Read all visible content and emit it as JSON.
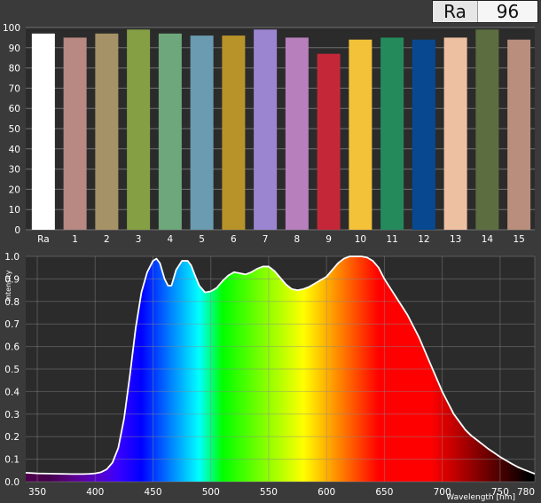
{
  "ra_display": {
    "label": "Ra",
    "value": "96"
  },
  "chart_data": [
    {
      "type": "bar",
      "categories": [
        "Ra",
        "1",
        "2",
        "3",
        "4",
        "5",
        "6",
        "7",
        "8",
        "9",
        "10",
        "11",
        "12",
        "13",
        "14",
        "15"
      ],
      "values": [
        97,
        95,
        97,
        99,
        97,
        96,
        96,
        99,
        95,
        87,
        94,
        95,
        94,
        95,
        99,
        94
      ],
      "colors": [
        "#ffffff",
        "#b88882",
        "#a59266",
        "#85a044",
        "#6ea77c",
        "#6a9bb0",
        "#b8932a",
        "#9c85d0",
        "#b87fbd",
        "#c42838",
        "#f4c238",
        "#248a5c",
        "#084890",
        "#eec0a2",
        "#5c6d40",
        "#b98e7d"
      ],
      "ylim": [
        0,
        100
      ],
      "yticks": [
        0,
        10,
        20,
        30,
        40,
        50,
        60,
        70,
        80,
        90,
        100
      ],
      "grid": true
    },
    {
      "type": "area",
      "xlabel": "Wavelength [nm]",
      "ylabel": "Intensity",
      "xlim": [
        340,
        780
      ],
      "ylim": [
        0,
        1.0
      ],
      "xticks": [
        350,
        400,
        450,
        500,
        550,
        600,
        650,
        700,
        750,
        780
      ],
      "yticks": [
        "0.0",
        "0.1",
        "0.2",
        "0.3",
        "0.4",
        "0.5",
        "0.6",
        "0.7",
        "0.8",
        "0.9",
        "1.0"
      ],
      "grid": true,
      "x": [
        340,
        350,
        360,
        370,
        380,
        390,
        395,
        400,
        405,
        410,
        415,
        420,
        425,
        430,
        435,
        440,
        445,
        450,
        453,
        456,
        460,
        463,
        466,
        470,
        475,
        480,
        483,
        486,
        490,
        495,
        500,
        505,
        510,
        515,
        520,
        525,
        530,
        535,
        540,
        545,
        550,
        555,
        560,
        565,
        570,
        575,
        580,
        585,
        590,
        595,
        600,
        605,
        610,
        615,
        620,
        625,
        630,
        635,
        640,
        645,
        650,
        655,
        660,
        665,
        670,
        675,
        680,
        685,
        690,
        695,
        700,
        705,
        710,
        715,
        720,
        725,
        730,
        735,
        740,
        745,
        750,
        755,
        760,
        765,
        770,
        775,
        780
      ],
      "y": [
        0.04,
        0.037,
        0.036,
        0.035,
        0.034,
        0.034,
        0.035,
        0.037,
        0.042,
        0.055,
        0.085,
        0.15,
        0.28,
        0.47,
        0.68,
        0.84,
        0.93,
        0.98,
        0.99,
        0.97,
        0.9,
        0.87,
        0.87,
        0.94,
        0.98,
        0.98,
        0.96,
        0.92,
        0.87,
        0.84,
        0.845,
        0.86,
        0.89,
        0.915,
        0.93,
        0.925,
        0.92,
        0.93,
        0.945,
        0.955,
        0.955,
        0.935,
        0.905,
        0.875,
        0.855,
        0.85,
        0.855,
        0.865,
        0.88,
        0.895,
        0.91,
        0.94,
        0.97,
        0.99,
        1.0,
        1.0,
        1.0,
        0.995,
        0.98,
        0.95,
        0.9,
        0.86,
        0.82,
        0.78,
        0.74,
        0.69,
        0.64,
        0.58,
        0.52,
        0.46,
        0.4,
        0.35,
        0.3,
        0.265,
        0.23,
        0.205,
        0.185,
        0.165,
        0.145,
        0.128,
        0.11,
        0.095,
        0.08,
        0.066,
        0.055,
        0.045,
        0.035
      ]
    }
  ]
}
